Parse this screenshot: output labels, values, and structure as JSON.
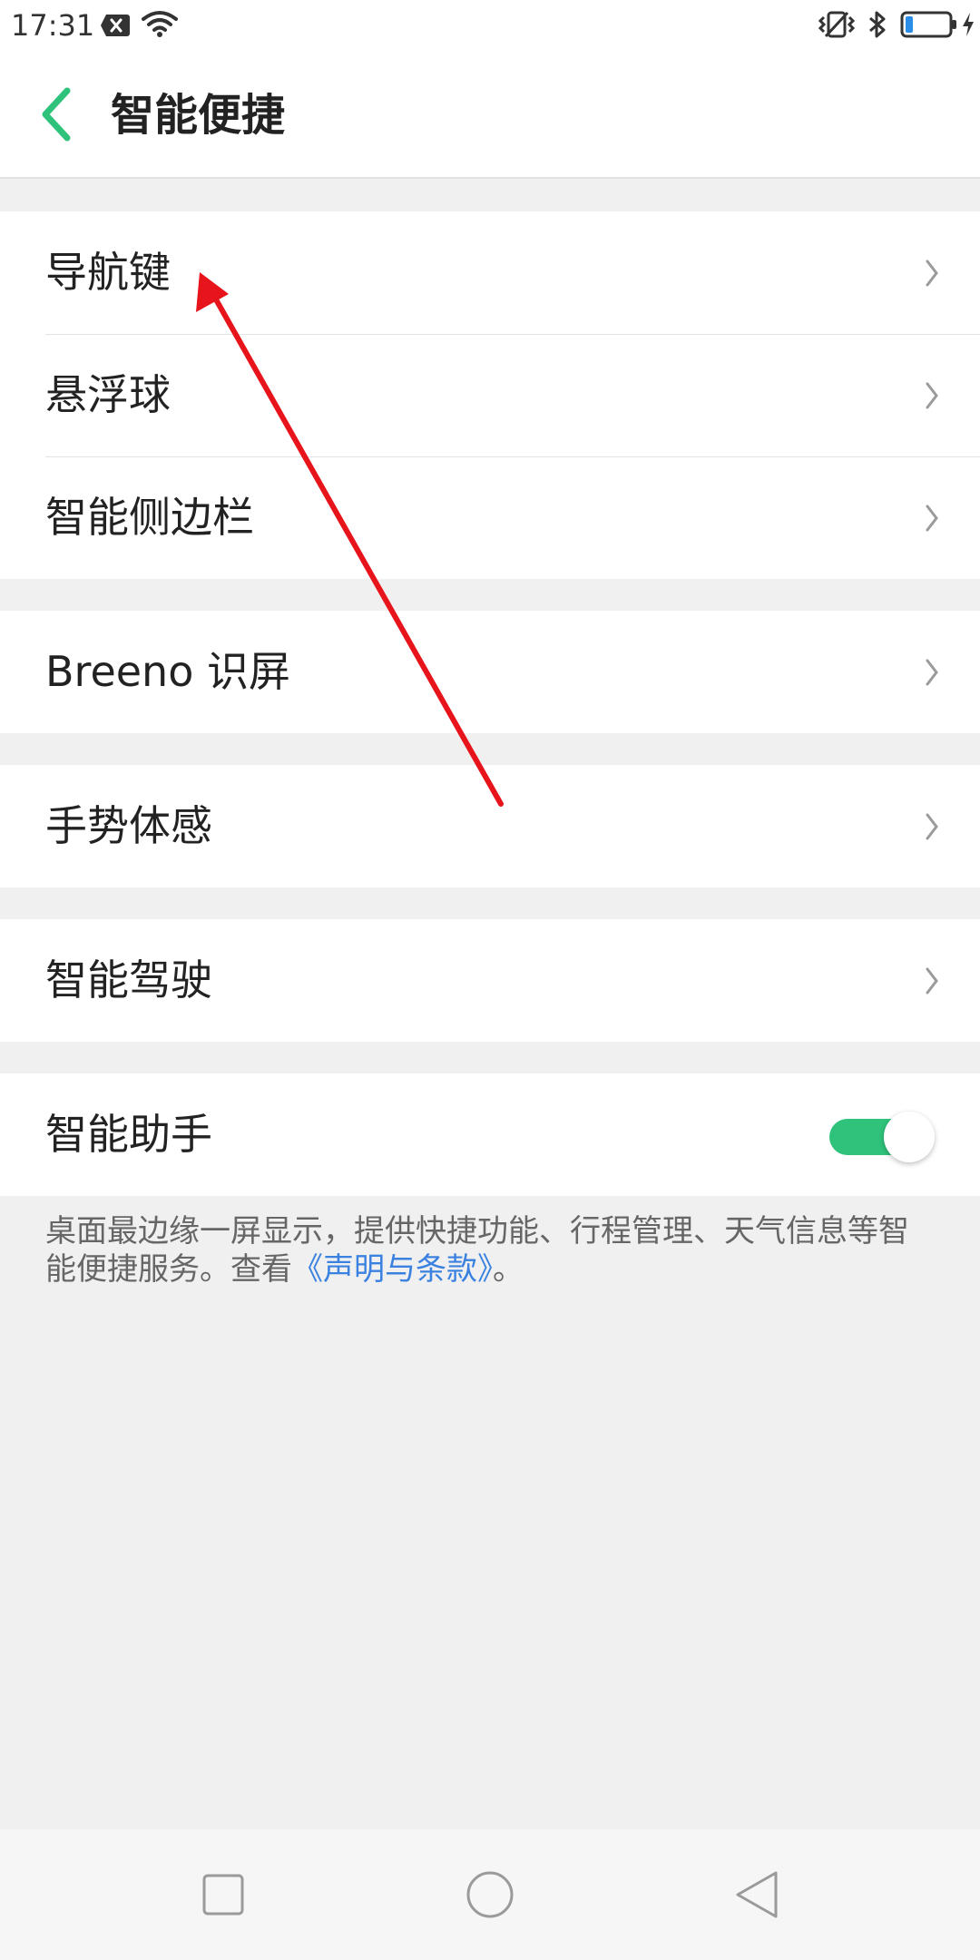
{
  "status_bar": {
    "time": "17:31",
    "icons": [
      "sim-off-icon",
      "wifi-icon",
      "vibrate-icon",
      "bluetooth-icon",
      "battery-icon",
      "charging-icon"
    ]
  },
  "header": {
    "back_icon": "back-chevron-icon",
    "title": "智能便捷"
  },
  "groups": [
    {
      "items": [
        {
          "label": "导航键",
          "control": "chevron"
        },
        {
          "label": "悬浮球",
          "control": "chevron"
        },
        {
          "label": "智能侧边栏",
          "control": "chevron"
        }
      ]
    },
    {
      "items": [
        {
          "label": "Breeno 识屏",
          "control": "chevron"
        }
      ]
    },
    {
      "items": [
        {
          "label": "手势体感",
          "control": "chevron"
        }
      ]
    },
    {
      "items": [
        {
          "label": "智能驾驶",
          "control": "chevron"
        }
      ]
    },
    {
      "items": [
        {
          "label": "智能助手",
          "control": "toggle",
          "toggle_on": true
        }
      ]
    }
  ],
  "footnote": {
    "text": "桌面最边缘一屏显示，提供快捷功能、行程管理、天气信息等智能便捷服务。查看",
    "link": "《声明与条款》",
    "suffix": "。"
  },
  "nav_bar": {
    "buttons": [
      "recent-apps-icon",
      "home-icon",
      "back-icon"
    ]
  },
  "colors": {
    "accent": "#2fc27a",
    "link": "#3b82e0",
    "annotation": "#e8141c",
    "background": "#f0f0f0"
  }
}
